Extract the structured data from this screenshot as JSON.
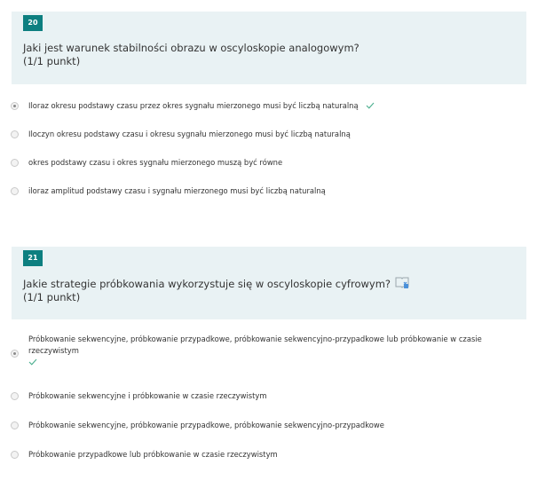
{
  "questions": [
    {
      "number": "20",
      "title": "Jaki jest warunek stabilności obrazu w oscyloskopie analogowym?",
      "points": "(1/1 punkt)",
      "options": [
        {
          "label": "Iloraz okresu podstawy czasu przez okres sygnału mierzonego musi być liczbą naturalną",
          "selected": true,
          "correct": true
        },
        {
          "label": "Iloczyn okresu podstawy czasu i okresu sygnału mierzonego musi być liczbą naturalną",
          "selected": false,
          "correct": false
        },
        {
          "label": "okres podstawy czasu i okres sygnału mierzonego muszą być równe",
          "selected": false,
          "correct": false
        },
        {
          "label": "iloraz amplitud podstawy czasu i sygnału mierzonego musi być liczbą naturalną",
          "selected": false,
          "correct": false
        }
      ]
    },
    {
      "number": "21",
      "title": "Jakie strategie próbkowania wykorzystuje się w oscyloskopie cyfrowym?",
      "points": "(1/1 punkt)",
      "title_icon": "immersive-reader-icon",
      "options": [
        {
          "label": "Próbkowanie sekwencyjne, próbkowanie przypadkowe, próbkowanie sekwencyjno-przypadkowe lub próbkowanie w czasie rzeczywistym",
          "selected": true,
          "correct": true
        },
        {
          "label": "Próbkowanie sekwencyjne i próbkowanie w czasie rzeczywistym",
          "selected": false,
          "correct": false
        },
        {
          "label": "Próbkowanie sekwencyjne, próbkowanie przypadkowe, próbkowanie sekwencyjno-przypadkowe",
          "selected": false,
          "correct": false
        },
        {
          "label": "Próbkowanie przypadkowe lub próbkowanie w czasie rzeczywistym",
          "selected": false,
          "correct": false
        }
      ]
    }
  ],
  "colors": {
    "header_bg": "#e9f2f4",
    "badge_bg": "#0d7f80",
    "check": "#4caf8f",
    "icon": "#4a90d9"
  }
}
